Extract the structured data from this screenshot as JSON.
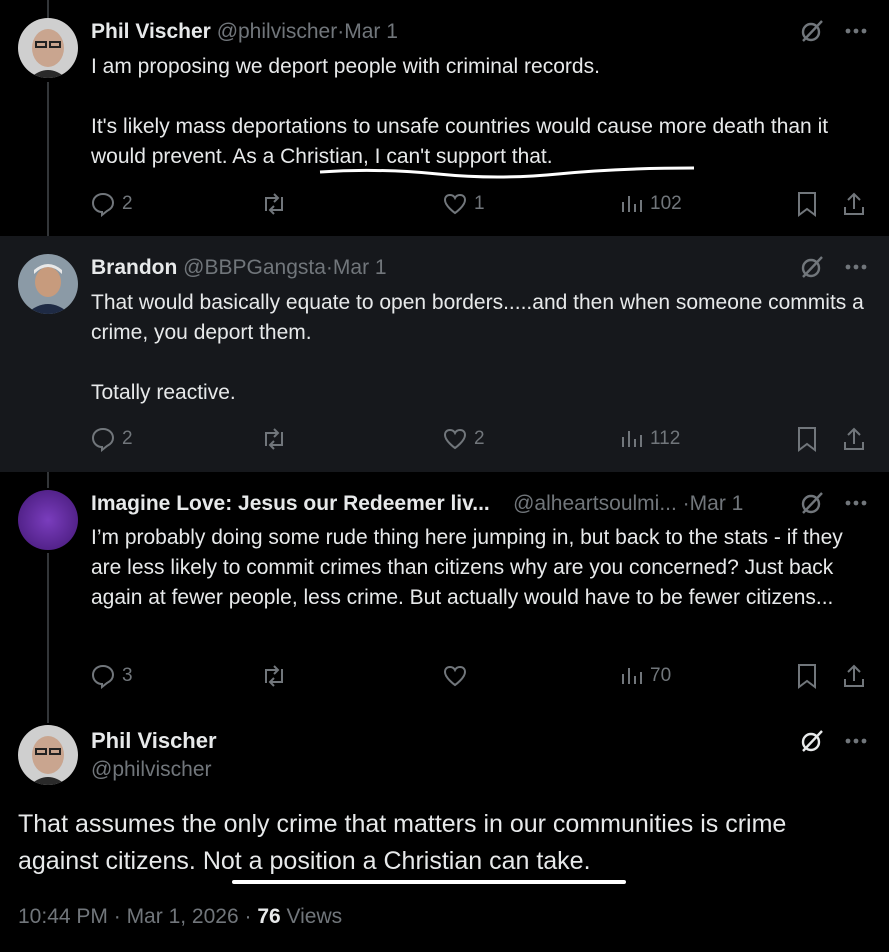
{
  "tweets": [
    {
      "name": "Phil Vischer",
      "handle": "@philvischer",
      "dot": " · ",
      "date": "Mar 1",
      "text": "I am proposing we deport people with criminal records.\n\nIt's likely mass deportations to unsafe countries would cause more death than it would prevent. ",
      "highlight": "As a Christian, I can't support that.",
      "replies": "2",
      "retweets": "",
      "likes": "1",
      "views": "102"
    },
    {
      "name": "Brandon",
      "handle": "@BBPGangsta",
      "dot": " · ",
      "date": "Mar 1",
      "text": "That would basically equate to open borders.....and then when someone commits a crime, you deport them.\n\nTotally reactive.",
      "replies": "2",
      "retweets": "",
      "likes": "2",
      "views": "112"
    },
    {
      "name": "Imagine Love: Jesus our Redeemer liv...",
      "handle": "@alheartsoulmi...",
      "dot": " · ",
      "date": "Mar 1",
      "text": "I’m probably doing some rude thing here jumping in, but back to the stats - if they are less likely to commit crimes than citizens why are you concerned? Just back again at fewer people, less crime.  But actually would have to be fewer citizens...",
      "replies": "3",
      "retweets": "",
      "likes": "",
      "views": "70"
    }
  ],
  "main": {
    "name": "Phil Vischer",
    "handle": "@philvischer",
    "text": "That assumes the only crime that matters in our communities is crime against citizens.  ",
    "highlight": "Not a position a Christian can take.",
    "time": "10:44 PM",
    "dot": " · ",
    "date": "Mar 1, 2026",
    "views_count": "76",
    "views_label": " Views"
  },
  "colors": {
    "muted": "#71767b",
    "text": "#e7e9ea",
    "alt_bg": "#16181c"
  },
  "icons": [
    "reply-icon",
    "retweet-icon",
    "like-icon",
    "views-icon",
    "bookmark-icon",
    "share-icon",
    "grok-icon",
    "more-icon"
  ]
}
